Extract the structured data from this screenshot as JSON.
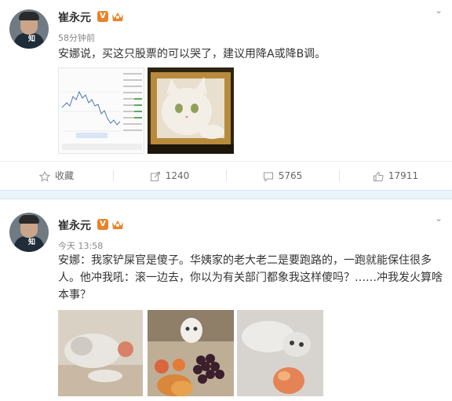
{
  "posts": [
    {
      "author": "崔永元",
      "verified_mark": "V",
      "time": "58分钟前",
      "text": "安娜说，买这只股票的可以哭了，建议用降A或降B调。",
      "actions": {
        "favorite": "收藏",
        "repost": "1240",
        "comment": "5765",
        "like": "17911"
      }
    },
    {
      "author": "崔永元",
      "verified_mark": "V",
      "time": "今天 13:58",
      "text": "安娜：我家铲屎官是傻子。华姨家的老大老二是要跑路的，一跑就能保住很多人。他冲我吼：滚一边去，你以为有关部门都象我这样傻吗？……冲我发火算啥本事？"
    }
  ],
  "icons": [
    "star-icon",
    "repost-icon",
    "comment-icon",
    "thumbs-up-icon",
    "chevron-down-icon",
    "crown-icon"
  ],
  "colors": {
    "accent_orange": "#e8832a",
    "divider_blue": "#eaf4fb"
  }
}
